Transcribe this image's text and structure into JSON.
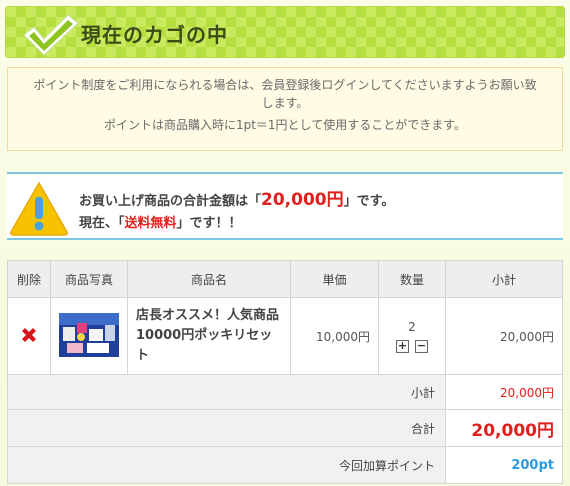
{
  "header": {
    "title": "現在のカゴの中",
    "icon": "checkmark-icon"
  },
  "notice": {
    "line1": "ポイント制度をご利用になられる場合は、会員登録後ログインしてくださいますようお願い致します。",
    "line2": "ポイントは商品購入時に1pt＝1円として使用することができます。"
  },
  "total_box": {
    "icon": "warning-icon",
    "line1_prefix": "お買い上げ商品の合計金額は「",
    "line1_amount": "20,000円",
    "line1_suffix": "」です。",
    "line2_prefix": "現在、「",
    "line2_highlight": "送料無料",
    "line2_suffix": "」です！！"
  },
  "table": {
    "headers": [
      "削除",
      "商品写真",
      "商品名",
      "単価",
      "数量",
      "小計"
    ],
    "items": [
      {
        "delete_icon": "delete-x-icon",
        "name": "店長オススメ！人気商品10000円ポッキリセット",
        "price": "10,000円",
        "qty": "2",
        "qty_plus": "+",
        "qty_minus": "−",
        "subtotal": "20,000円"
      }
    ],
    "summary": {
      "subtotal_label": "小計",
      "subtotal_value": "20,000円",
      "total_label": "合計",
      "total_value": "20,000円",
      "points_label": "今回加算ポイント",
      "points_value": "200pt"
    }
  },
  "colors": {
    "accent_red": "#e0201c",
    "points_blue": "#2a9be0",
    "header_green": "#c9ea5f"
  }
}
